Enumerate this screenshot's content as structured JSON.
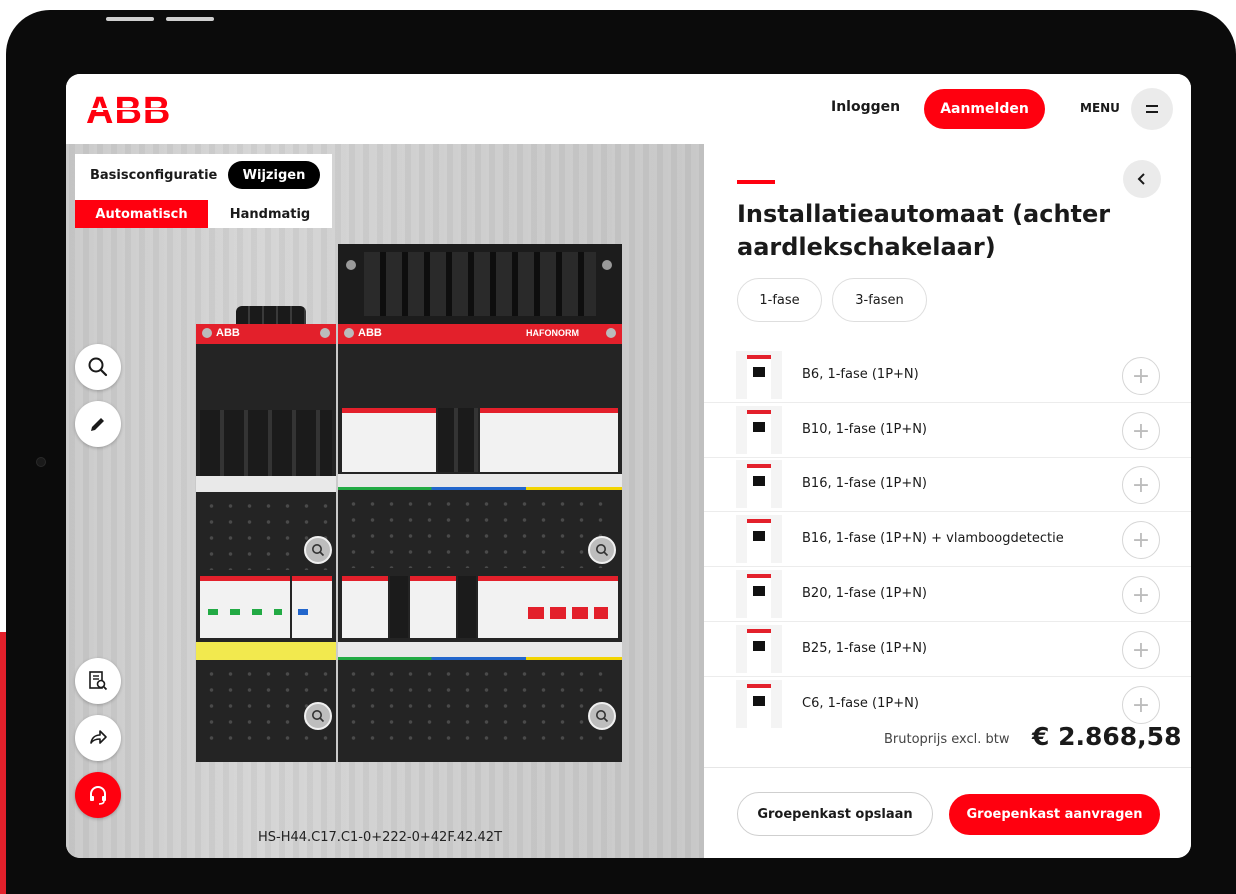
{
  "header": {
    "logo_text": "ABB",
    "login_label": "Inloggen",
    "signup_label": "Aanmelden",
    "menu_label": "MENU",
    "menu_icon": "hamburger-icon"
  },
  "configurator": {
    "base_config_label": "Basisconfiguratie",
    "change_label": "Wijzigen",
    "mode_auto_label": "Automatisch",
    "mode_manual_label": "Handmatig",
    "config_code": "HS-H44.C17.C1-0+222-0+42F.42.42T",
    "panel_brand_left": "ABB",
    "panel_brand_right": "ABB",
    "panel_model": "HAFONORM",
    "tools": [
      "search-icon",
      "pencil-icon",
      "document-search-icon",
      "share-icon",
      "headset-icon"
    ]
  },
  "product": {
    "title": "Installatieautomaat (achter aardlekschakelaar)",
    "phase_options": [
      "1-fase",
      "3-fasen"
    ],
    "items": [
      {
        "label": "B6, 1-fase (1P+N)"
      },
      {
        "label": "B10, 1-fase (1P+N)"
      },
      {
        "label": "B16, 1-fase (1P+N)"
      },
      {
        "label": "B16, 1-fase (1P+N) + vlamboogdetectie"
      },
      {
        "label": "B20, 1-fase (1P+N)"
      },
      {
        "label": "B25, 1-fase (1P+N)"
      },
      {
        "label": "C6, 1-fase (1P+N)"
      }
    ]
  },
  "footer": {
    "price_label": "Brutoprijs excl. btw",
    "price_value": "€ 2.868,58",
    "save_label": "Groepenkast opslaan",
    "request_label": "Groepenkast aanvragen"
  },
  "colors": {
    "brand_red": "#ff000f",
    "background_red": "#e3202b"
  }
}
